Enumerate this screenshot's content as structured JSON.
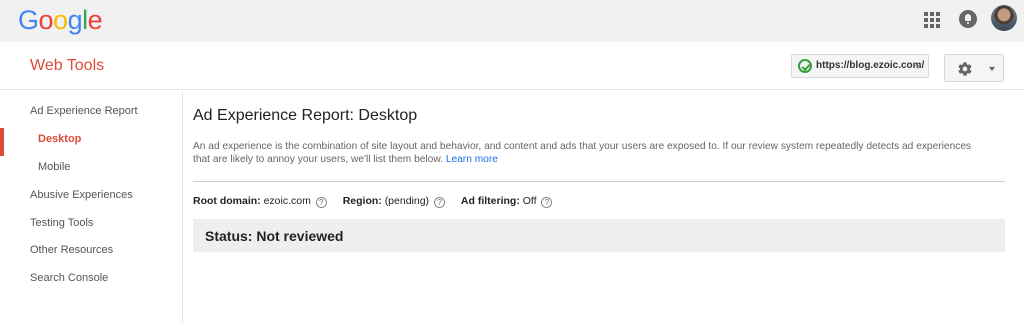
{
  "brand": {
    "logo_letters": [
      "G",
      "o",
      "o",
      "g",
      "l",
      "e"
    ],
    "logo_colors": [
      "#4285f4",
      "#ea4335",
      "#fbbc05",
      "#4285f4",
      "#34a853",
      "#ea4335"
    ]
  },
  "header": {
    "app_title": "Web Tools",
    "property_url": "https://blog.ezoic.com/"
  },
  "sidebar": {
    "items": [
      {
        "label": "Ad Experience Report"
      },
      {
        "label": "Desktop"
      },
      {
        "label": "Mobile"
      },
      {
        "label": "Abusive Experiences"
      },
      {
        "label": "Testing Tools"
      },
      {
        "label": "Other Resources"
      },
      {
        "label": "Search Console"
      }
    ]
  },
  "main": {
    "title": "Ad Experience Report: Desktop",
    "intro": "An ad experience is the combination of site layout and behavior, and content and ads that your users are exposed to. If our review system repeatedly detects ad experiences that are likely to annoy your users, we'll list them below.",
    "learn_more": "Learn more",
    "root_domain_label": "Root domain:",
    "root_domain_value": "ezoic.com",
    "region_label": "Region:",
    "region_value": "(pending)",
    "ad_filtering_label": "Ad filtering:",
    "ad_filtering_value": "Off",
    "help_glyph": "?",
    "status": "Status: Not reviewed"
  },
  "colors": {
    "accent": "#dd4b39",
    "link": "#1a73e8",
    "verified": "#37a03a"
  }
}
